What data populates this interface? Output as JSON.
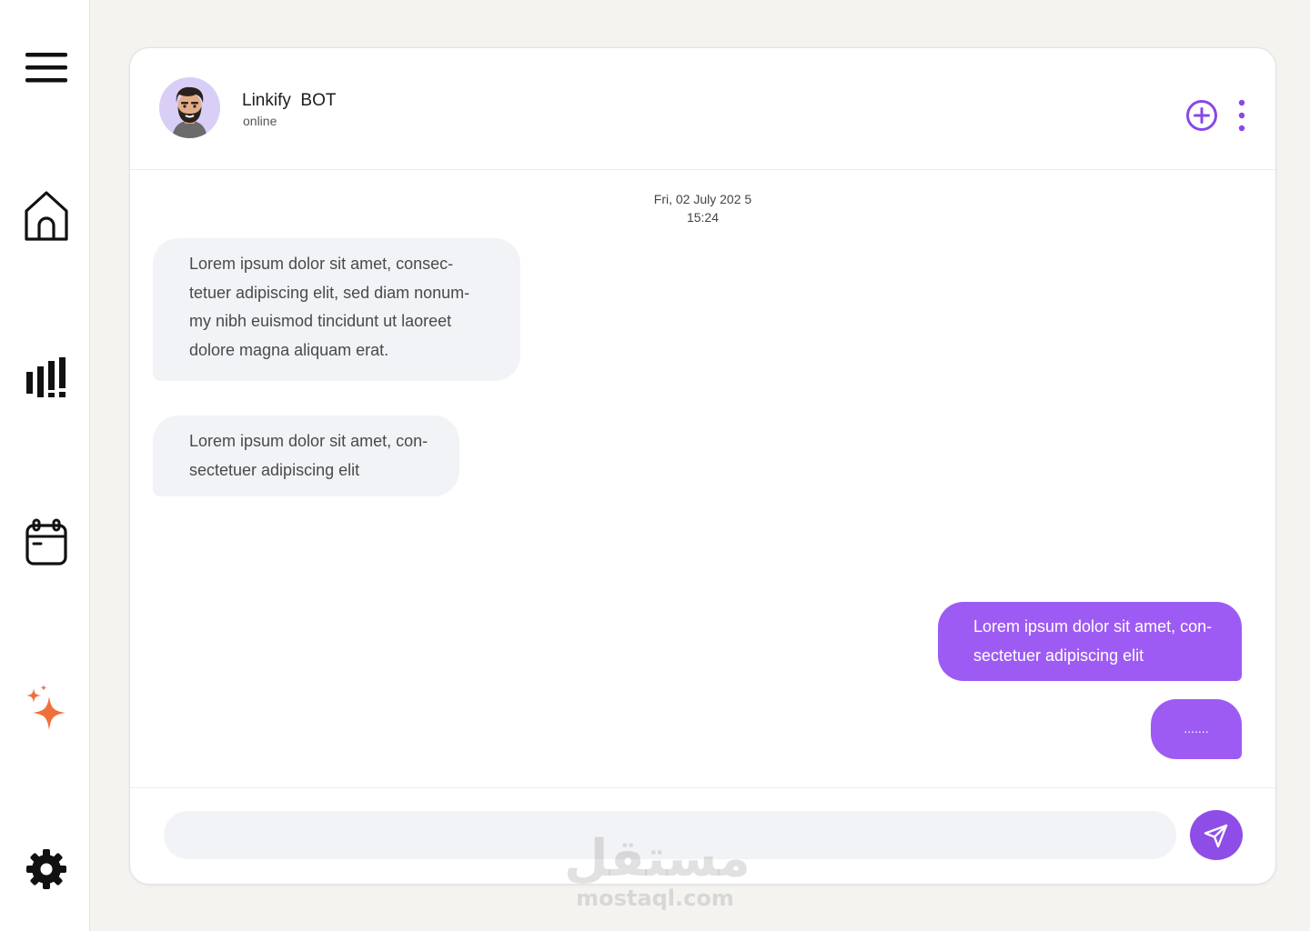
{
  "sidebar": {
    "items": [
      {
        "name": "menu",
        "icon": "hamburger-menu-icon"
      },
      {
        "name": "home",
        "icon": "home-icon"
      },
      {
        "name": "stats",
        "icon": "bar-chart-icon"
      },
      {
        "name": "calendar",
        "icon": "calendar-icon"
      },
      {
        "name": "ai",
        "icon": "sparkles-icon"
      },
      {
        "name": "settings",
        "icon": "gear-icon"
      }
    ]
  },
  "chat": {
    "bot_name": "Linkify  BOT",
    "status": "online",
    "date": "Fri, 02 July 202 5",
    "time": "15:24",
    "messages": [
      {
        "direction": "in",
        "text": "Lorem ipsum dolor sit amet, consec-\ntetuer adipiscing elit, sed diam nonum-\nmy nibh euismod tincidunt ut laoreet\ndolore magna aliquam erat."
      },
      {
        "direction": "in",
        "text": "Lorem ipsum dolor sit amet, con-\nsectetuer adipiscing elit"
      },
      {
        "direction": "out",
        "text": "Lorem ipsum dolor sit amet, con-\nsectetuer adipiscing elit"
      },
      {
        "direction": "out",
        "text": "......."
      }
    ],
    "input": {
      "value": "",
      "placeholder": ""
    }
  },
  "watermark": {
    "arabic": "مستقل",
    "latin": "mostaql.com"
  },
  "colors": {
    "accent": "#9e5bf3",
    "accent_dark": "#8f4de8",
    "sparkle": "#f0703a",
    "bubble_in": "#f2f3f6",
    "page_bg": "#f4f3f0"
  }
}
